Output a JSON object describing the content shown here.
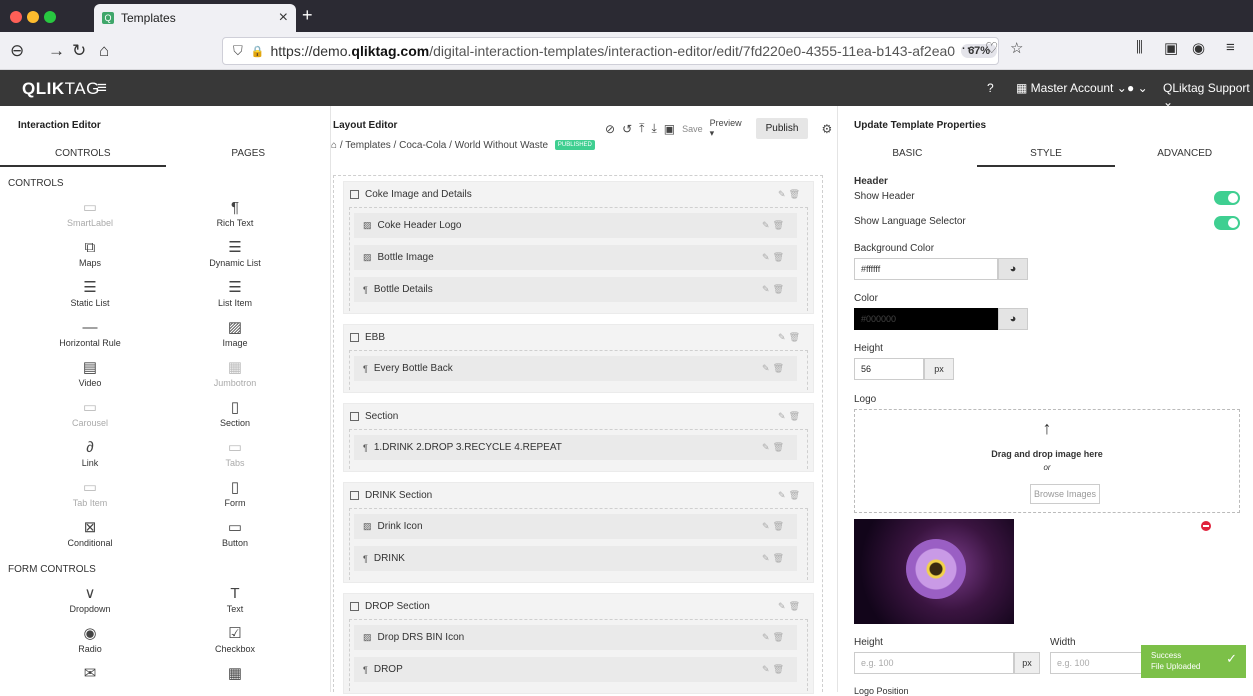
{
  "browser": {
    "tab_title": "Templates",
    "url_scheme": "https://demo.",
    "url_domain": "qliktag.com",
    "url_path": "/digital-interaction-templates/interaction-editor/edit/7fd220e0-4355-11ea-b143-af2ea0",
    "zoom": "67%"
  },
  "app": {
    "logo_bold": "QLIK",
    "logo_thin": "TAG",
    "account": "Master Account",
    "user": "QLiktag Support"
  },
  "left": {
    "title": "Interaction Editor",
    "tabs": [
      "CONTROLS",
      "PAGES"
    ],
    "controls_label": "CONTROLS",
    "controls": [
      {
        "label": "SmartLabel",
        "icon": "▭",
        "disabled": true
      },
      {
        "label": "Rich Text",
        "icon": "¶",
        "disabled": false
      },
      {
        "label": "Maps",
        "icon": "⧉",
        "disabled": false
      },
      {
        "label": "Dynamic List",
        "icon": "☰",
        "disabled": false
      },
      {
        "label": "Static List",
        "icon": "☰",
        "disabled": false
      },
      {
        "label": "List Item",
        "icon": "☰",
        "disabled": false
      },
      {
        "label": "Horizontal Rule",
        "icon": "—",
        "disabled": false
      },
      {
        "label": "Image",
        "icon": "▨",
        "disabled": false
      },
      {
        "label": "Video",
        "icon": "▤",
        "disabled": false
      },
      {
        "label": "Jumbotron",
        "icon": "▦",
        "disabled": true
      },
      {
        "label": "Carousel",
        "icon": "▭",
        "disabled": true
      },
      {
        "label": "Section",
        "icon": "▯",
        "disabled": false
      },
      {
        "label": "Link",
        "icon": "∂",
        "disabled": false
      },
      {
        "label": "Tabs",
        "icon": "▭",
        "disabled": true
      },
      {
        "label": "Tab Item",
        "icon": "▭",
        "disabled": true
      },
      {
        "label": "Form",
        "icon": "▯",
        "disabled": false
      },
      {
        "label": "Conditional",
        "icon": "⊠",
        "disabled": false
      },
      {
        "label": "Button",
        "icon": "▭",
        "disabled": false
      }
    ],
    "form_label": "FORM CONTROLS",
    "form_controls": [
      {
        "label": "Dropdown",
        "icon": "∨"
      },
      {
        "label": "Text",
        "icon": "T"
      },
      {
        "label": "Radio",
        "icon": "◉"
      },
      {
        "label": "Checkbox",
        "icon": "☑"
      },
      {
        "label": "",
        "icon": "✉"
      },
      {
        "label": "",
        "icon": "▦"
      }
    ]
  },
  "layout": {
    "title": "Layout Editor",
    "save": "Save",
    "preview": "Preview",
    "publish": "Publish",
    "breadcrumb": [
      "Templates",
      "Coca-Cola",
      "World Without Waste"
    ],
    "status_badge": "PUBLISHED",
    "sections": [
      {
        "name": "Coke Image and Details",
        "items": [
          {
            "name": "Coke Header Logo",
            "type": "image"
          },
          {
            "name": "Bottle Image",
            "type": "image"
          },
          {
            "name": "Bottle Details",
            "type": "text"
          }
        ]
      },
      {
        "name": "EBB",
        "items": [
          {
            "name": "Every Bottle Back",
            "type": "text"
          }
        ]
      },
      {
        "name": "Section",
        "items": [
          {
            "name": "1.DRINK 2.DROP 3.RECYCLE 4.REPEAT",
            "type": "text"
          }
        ]
      },
      {
        "name": "DRINK Section",
        "items": [
          {
            "name": "Drink Icon",
            "type": "image"
          },
          {
            "name": "DRINK",
            "type": "text"
          }
        ]
      },
      {
        "name": "DROP Section",
        "items": [
          {
            "name": "Drop DRS BIN Icon",
            "type": "image"
          },
          {
            "name": "DROP",
            "type": "text"
          }
        ]
      }
    ]
  },
  "props": {
    "title": "Update Template Properties",
    "tabs": [
      "BASIC",
      "STYLE",
      "ADVANCED"
    ],
    "header_label": "Header",
    "show_header": "Show Header",
    "show_lang": "Show Language Selector",
    "bg_label": "Background Color",
    "bg_value": "#ffffff",
    "color_label": "Color",
    "color_value": "#000000",
    "height_label": "Height",
    "height_value": "56",
    "unit": "px",
    "logo_label": "Logo",
    "drop_text": "Drag and drop image here",
    "or": "or",
    "browse": "Browse Images",
    "height2": "Height",
    "width2": "Width",
    "placeholder": "e.g. 100",
    "logo_position": "Logo Position"
  },
  "toast": {
    "title": "Success",
    "message": "File Uploaded",
    "color": "#7cc048"
  }
}
